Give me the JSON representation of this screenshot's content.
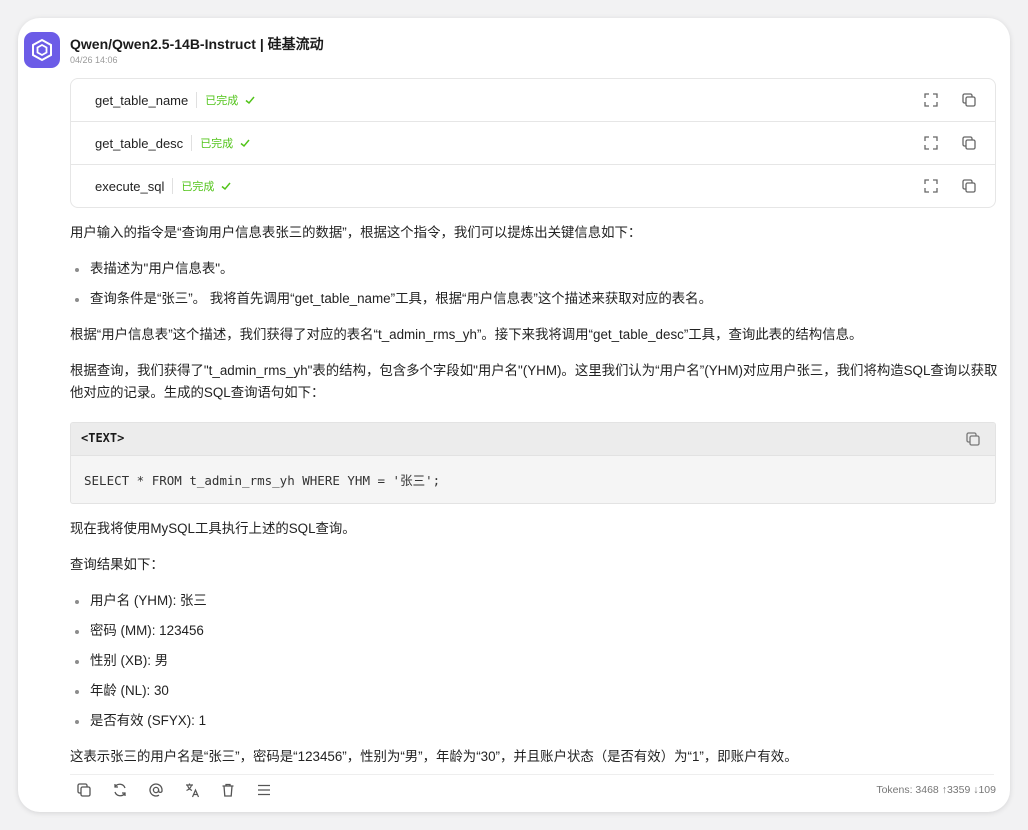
{
  "message": {
    "title": "Qwen/Qwen2.5-14B-Instruct | 硅基流动",
    "time": "04/26 14:06"
  },
  "tool_calls": [
    {
      "name": "get_table_name",
      "status": "已完成"
    },
    {
      "name": "get_table_desc",
      "status": "已完成"
    },
    {
      "name": "execute_sql",
      "status": "已完成"
    }
  ],
  "body": {
    "intro": "用户输入的指令是“查询用户信息表张三的数据”，根据这个指令，我们可以提炼出关键信息如下：",
    "bullets1": [
      "表描述为\"用户信息表\"。",
      "查询条件是“张三”。 我将首先调用“get_table_name”工具，根据“用户信息表”这个描述来获取对应的表名。"
    ],
    "para2": "根据“用户信息表”这个描述，我们获得了对应的表名“t_admin_rms_yh”。接下来我将调用“get_table_desc”工具，查询此表的结构信息。",
    "para3": "根据查询，我们获得了\"t_admin_rms_yh\"表的结构，包含多个字段如\"用户名\"(YHM)。这里我们认为“用户名”(YHM)对应用户张三，我们将构造SQL查询以获取他对应的记录。生成的SQL查询语句如下：",
    "code_lang": "<TEXT>",
    "code": "SELECT * FROM t_admin_rms_yh WHERE YHM = '张三';",
    "para4": "现在我将使用MySQL工具执行上述的SQL查询。",
    "para5": "查询结果如下：",
    "bullets2": [
      "用户名 (YHM): 张三",
      "密码 (MM): 123456",
      "性别 (XB): 男",
      "年龄 (NL): 30",
      "是否有效 (SFYX): 1"
    ],
    "para6": "这表示张三的用户名是“张三”，密码是“123456”，性别为“男”，年龄为“30”，并且账户状态（是否有效）为“1”，即账户有效。"
  },
  "footer": {
    "tokens": "Tokens: 3468 ↑3359 ↓109"
  },
  "colors": {
    "accent": "#6c5ce7",
    "success": "#52c41a"
  },
  "icons": [
    "app-logo-icon",
    "check-icon",
    "expand-icon",
    "copy-icon",
    "refresh-icon",
    "mention-icon",
    "translate-icon",
    "delete-icon",
    "menu-icon"
  ]
}
